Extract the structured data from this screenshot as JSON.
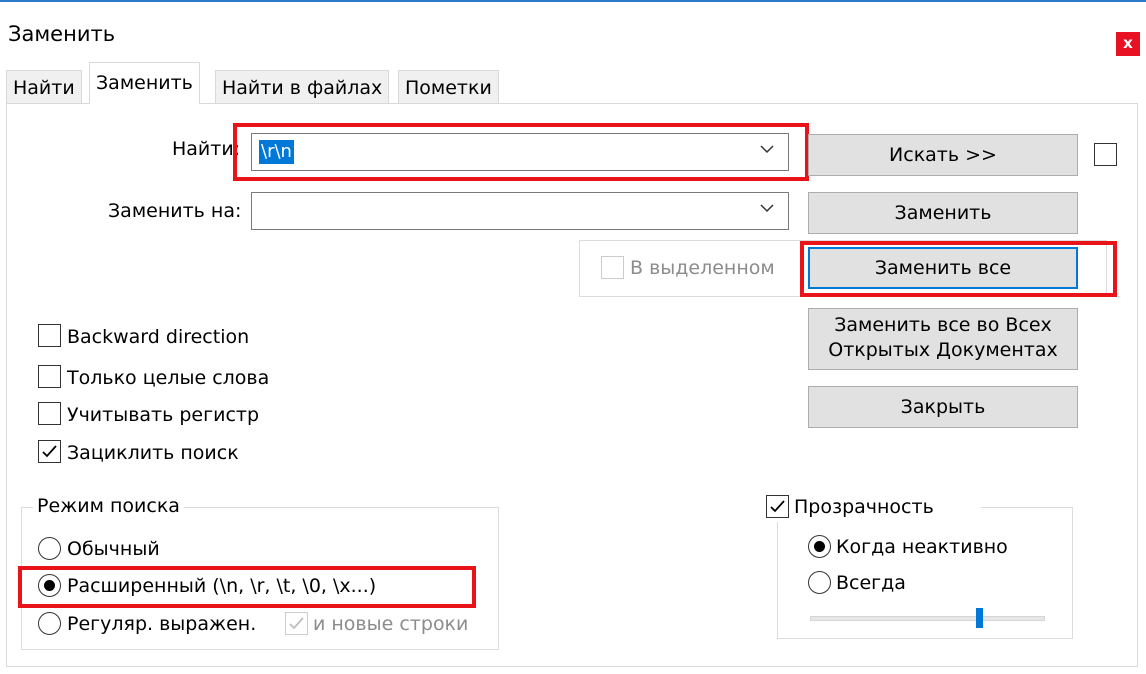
{
  "window": {
    "title": "Заменить",
    "close_label": "x"
  },
  "tabs": [
    {
      "label": "Найти"
    },
    {
      "label": "Заменить"
    },
    {
      "label": "Найти в файлах"
    },
    {
      "label": "Пометки"
    }
  ],
  "find": {
    "label": "Найти:",
    "value": "\\r\\n"
  },
  "replace": {
    "label": "Заменить на:",
    "value": ""
  },
  "in_selection": {
    "label": "В выделенном",
    "checked": false,
    "enabled": false
  },
  "buttons": {
    "search": "Искать >>",
    "replace": "Заменить",
    "replace_all": "Заменить все",
    "replace_all_docs_line1": "Заменить все во Всех",
    "replace_all_docs_line2": "Открытых Документах",
    "close": "Закрыть"
  },
  "options": [
    {
      "label": "Backward direction",
      "checked": false
    },
    {
      "label": "Только целые слова",
      "checked": false
    },
    {
      "label": "Учитывать регистр",
      "checked": false
    },
    {
      "label": "Зациклить поиск",
      "checked": true
    }
  ],
  "search_mode": {
    "title": "Режим поиска",
    "normal": "Обычный",
    "extended": "Расширенный (\\n, \\r, \\t, \\0, \\x...)",
    "regex": "Регуляр. выражен.",
    "newlines": "и новые строки",
    "selected": "extended"
  },
  "transparency": {
    "label": "Прозрачность",
    "checked": true,
    "inactive": "Когда неактивно",
    "always": "Всегда",
    "selected": "inactive",
    "level": 0.72
  },
  "colors": {
    "accent": "#0078d7",
    "highlight": "#e8141a",
    "close": "#e81123"
  }
}
